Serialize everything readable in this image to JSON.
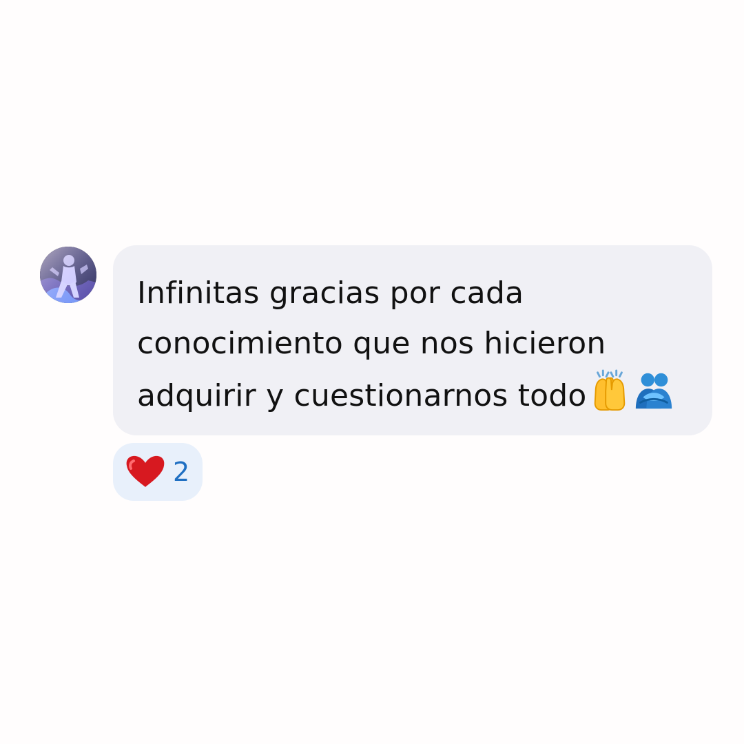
{
  "comment": {
    "text": "Infinitas gracias por cada\nconocimiento que nos hicieron\nadquirir y cuestionarnos todo",
    "emojis": [
      "raising-hands-icon",
      "people-hugging-icon"
    ]
  },
  "reactions": {
    "icon": "heart-icon",
    "count": "2"
  },
  "colors": {
    "background": "#fffdfd",
    "bubble": "#f0f0f5",
    "reaction_bg": "#e8f0fb",
    "reaction_count": "#1f6fc2",
    "heart": "#d71920"
  }
}
